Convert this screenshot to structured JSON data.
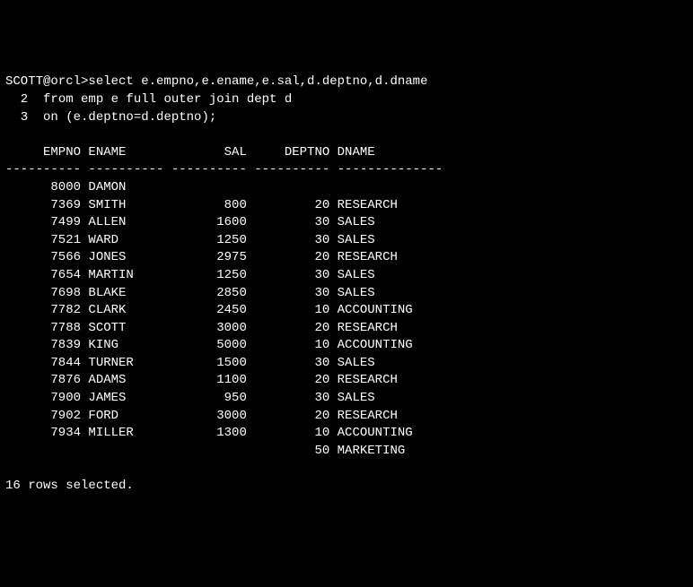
{
  "prompt": {
    "prefix": "SCOTT@orcl>",
    "sql_line1": "select e.empno,e.ename,e.sal,d.deptno,d.dname",
    "line2_num": "  2  ",
    "sql_line2": "from emp e full outer join dept d",
    "line3_num": "  3  ",
    "sql_line3": "on (e.deptno=d.deptno);"
  },
  "columns": [
    "EMPNO",
    "ENAME",
    "SAL",
    "DEPTNO",
    "DNAME"
  ],
  "rows": [
    {
      "empno": "8000",
      "ename": "DAMON",
      "sal": "",
      "deptno": "",
      "dname": ""
    },
    {
      "empno": "7369",
      "ename": "SMITH",
      "sal": "800",
      "deptno": "20",
      "dname": "RESEARCH"
    },
    {
      "empno": "7499",
      "ename": "ALLEN",
      "sal": "1600",
      "deptno": "30",
      "dname": "SALES"
    },
    {
      "empno": "7521",
      "ename": "WARD",
      "sal": "1250",
      "deptno": "30",
      "dname": "SALES"
    },
    {
      "empno": "7566",
      "ename": "JONES",
      "sal": "2975",
      "deptno": "20",
      "dname": "RESEARCH"
    },
    {
      "empno": "7654",
      "ename": "MARTIN",
      "sal": "1250",
      "deptno": "30",
      "dname": "SALES"
    },
    {
      "empno": "7698",
      "ename": "BLAKE",
      "sal": "2850",
      "deptno": "30",
      "dname": "SALES"
    },
    {
      "empno": "7782",
      "ename": "CLARK",
      "sal": "2450",
      "deptno": "10",
      "dname": "ACCOUNTING"
    },
    {
      "empno": "7788",
      "ename": "SCOTT",
      "sal": "3000",
      "deptno": "20",
      "dname": "RESEARCH"
    },
    {
      "empno": "7839",
      "ename": "KING",
      "sal": "5000",
      "deptno": "10",
      "dname": "ACCOUNTING"
    },
    {
      "empno": "7844",
      "ename": "TURNER",
      "sal": "1500",
      "deptno": "30",
      "dname": "SALES"
    },
    {
      "empno": "7876",
      "ename": "ADAMS",
      "sal": "1100",
      "deptno": "20",
      "dname": "RESEARCH"
    },
    {
      "empno": "7900",
      "ename": "JAMES",
      "sal": "950",
      "deptno": "30",
      "dname": "SALES"
    },
    {
      "empno": "7902",
      "ename": "FORD",
      "sal": "3000",
      "deptno": "20",
      "dname": "RESEARCH"
    },
    {
      "empno": "7934",
      "ename": "MILLER",
      "sal": "1300",
      "deptno": "10",
      "dname": "ACCOUNTING"
    },
    {
      "empno": "",
      "ename": "",
      "sal": "",
      "deptno": "50",
      "dname": "MARKETING"
    }
  ],
  "footer": "16 rows selected."
}
